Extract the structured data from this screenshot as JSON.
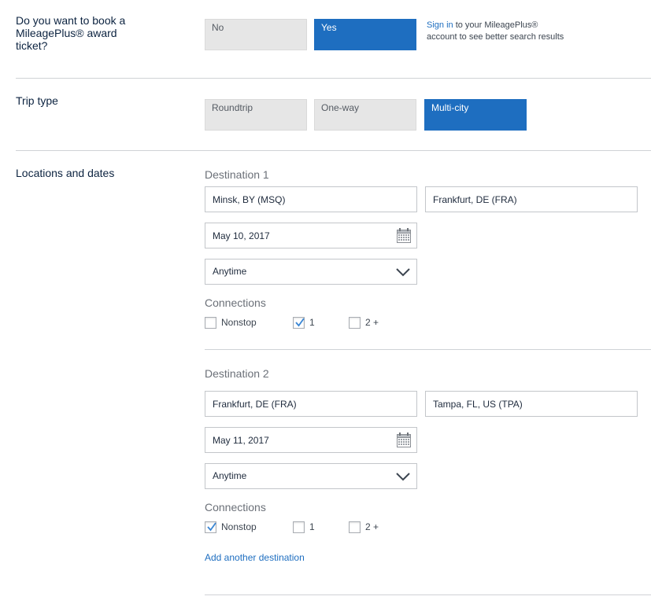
{
  "award": {
    "question": "Do you want to book a MileagePlus® award ticket?",
    "options": [
      "No",
      "Yes"
    ],
    "selected": "Yes",
    "signin_link": "Sign in",
    "signin_text": " to your MileagePlus® account to see better search results"
  },
  "trip_type": {
    "label": "Trip type",
    "options": [
      "Roundtrip",
      "One-way",
      "Multi-city"
    ],
    "selected": "Multi-city"
  },
  "locations": {
    "label": "Locations and dates",
    "destinations": [
      {
        "heading": "Destination 1",
        "from": "Minsk, BY (MSQ)",
        "to": "Frankfurt, DE (FRA)",
        "date": "May 10, 2017",
        "time": "Anytime",
        "connections_label": "Connections",
        "connections": [
          {
            "label": "Nonstop",
            "checked": false
          },
          {
            "label": "1",
            "checked": true
          },
          {
            "label": "2 +",
            "checked": false
          }
        ]
      },
      {
        "heading": "Destination 2",
        "from": "Frankfurt, DE (FRA)",
        "to": "Tampa, FL, US (TPA)",
        "date": "May 11, 2017",
        "time": "Anytime",
        "connections_label": "Connections",
        "connections": [
          {
            "label": "Nonstop",
            "checked": true
          },
          {
            "label": "1",
            "checked": false
          },
          {
            "label": "2 +",
            "checked": false
          }
        ]
      }
    ],
    "add_destination": "Add another destination"
  },
  "colors": {
    "accent": "#1e6ec0",
    "inactive": "#e6e6e6",
    "divider": "#cfd2d6"
  }
}
